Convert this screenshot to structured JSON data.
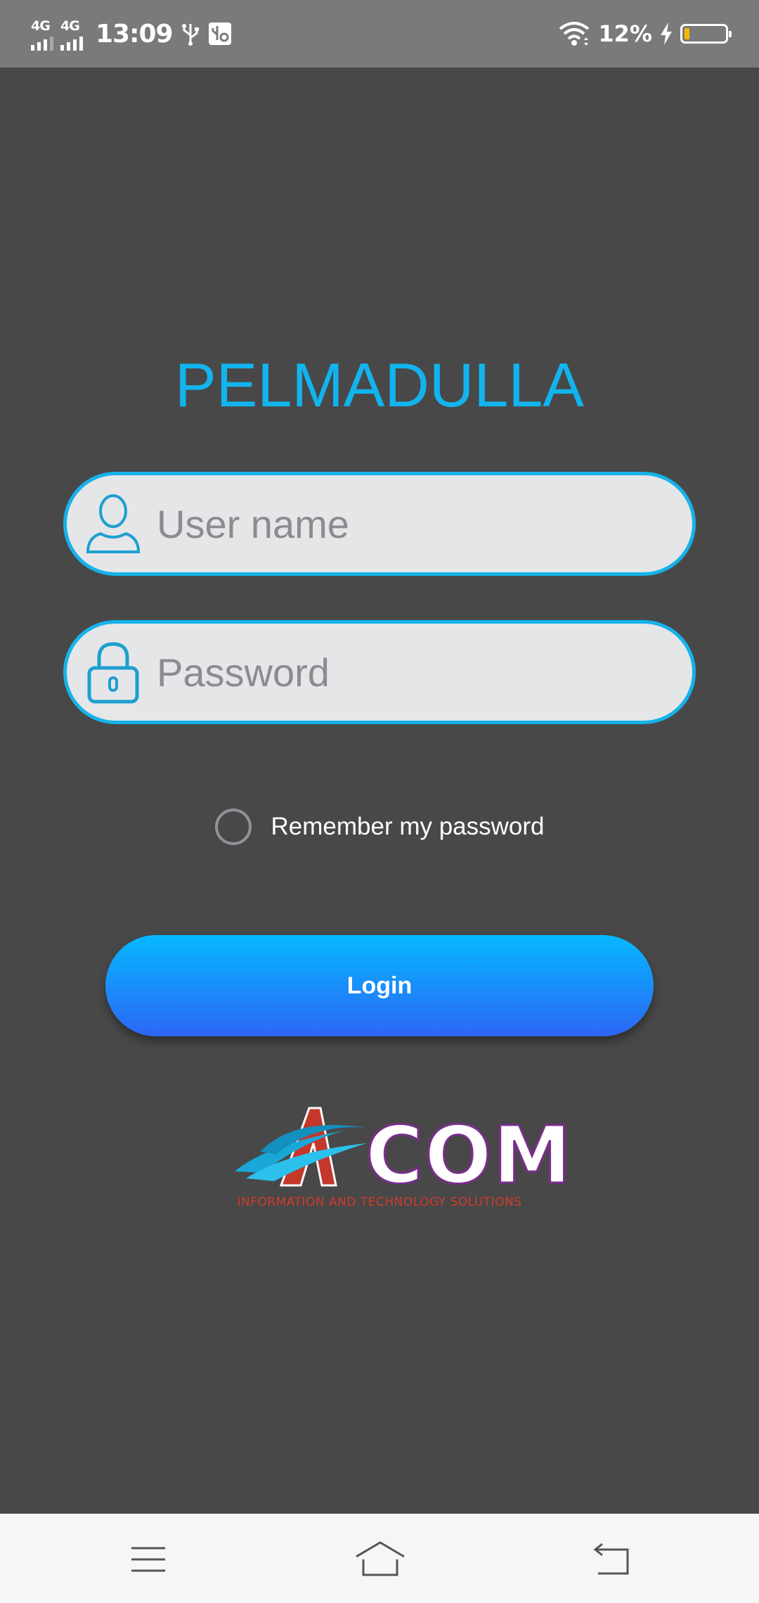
{
  "status_bar": {
    "network_1": "4G",
    "network_2": "4G",
    "time": "13:09",
    "battery_percent": "12%",
    "battery_level": 0.12,
    "icons": [
      "usb-icon",
      "usb-debug-icon",
      "wifi-icon",
      "charging-icon",
      "battery-icon"
    ]
  },
  "app": {
    "title": "PELMADULLA"
  },
  "login_form": {
    "username_placeholder": "User name",
    "password_placeholder": "Password",
    "remember_label": "Remember my password",
    "remember_checked": false,
    "login_label": "Login"
  },
  "logo": {
    "brand": "COM",
    "tagline": "INFORMATION AND TECHNOLOGY SOLUTIONS"
  },
  "nav_bar": {
    "icons": [
      "menu-icon",
      "home-icon",
      "back-icon"
    ]
  },
  "colors": {
    "accent": "#16b2ea",
    "background": "#484848",
    "button_top": "#05b9ff",
    "button_bottom": "#2d66f6"
  }
}
